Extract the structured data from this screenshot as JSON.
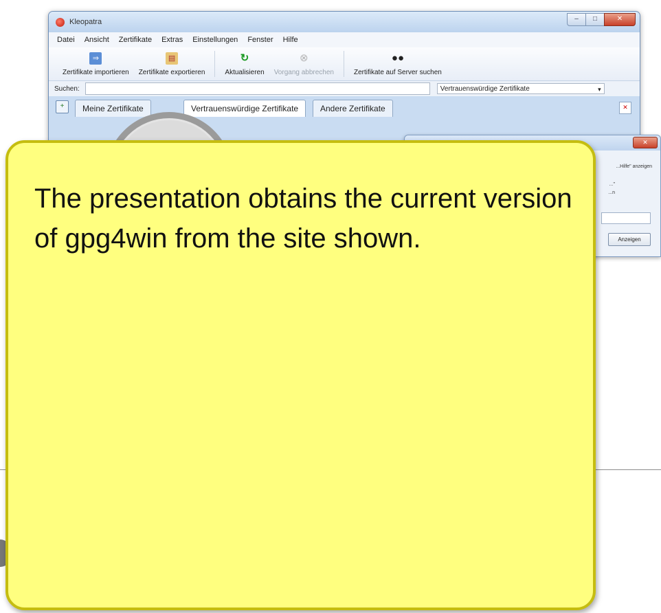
{
  "window": {
    "title": "Kleopatra",
    "buttons": {
      "minimize": "–",
      "maximize": "□",
      "close": "✕"
    }
  },
  "menu": [
    "Datei",
    "Ansicht",
    "Zertifikate",
    "Extras",
    "Einstellungen",
    "Fenster",
    "Hilfe"
  ],
  "toolbar": {
    "items": [
      {
        "label": "Zertifikate importieren",
        "icon": "import-icon",
        "enabled": true
      },
      {
        "label": "Zertifikate exportieren",
        "icon": "export-icon",
        "enabled": true
      },
      {
        "label": "Aktualisieren",
        "icon": "refresh-icon",
        "enabled": true
      },
      {
        "label": "Vorgang abbrechen",
        "icon": "stop-icon",
        "enabled": false
      },
      {
        "label": "Zertifikate auf Server suchen",
        "icon": "binoculars-icon",
        "enabled": true
      }
    ]
  },
  "search": {
    "label": "Suchen:",
    "value": "",
    "filter_selected": "Vertrauenswürdige Zertifikate"
  },
  "tabs": [
    {
      "label": "Meine Zertifikate"
    },
    {
      "label": "Vertrauenswürdige Zertifikate"
    },
    {
      "label": "Andere Zertifikate"
    }
  ],
  "dialog": {
    "text1": "...Hilfe\" anzeigen",
    "text2": "...\"",
    "text3": "...n",
    "button": "Anzeigen"
  },
  "callout": {
    "text": "The presentation obtains the current version of gpg4win from the site shown."
  }
}
